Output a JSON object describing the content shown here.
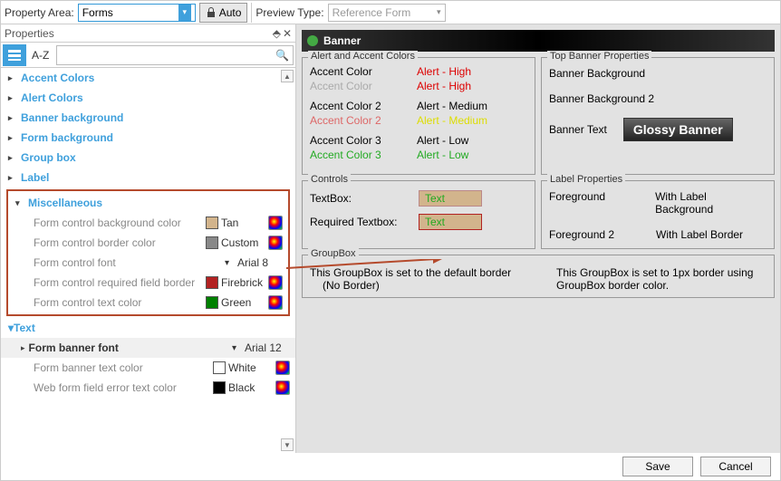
{
  "toolbar": {
    "propertyAreaLabel": "Property Area:",
    "propertyAreaValue": "Forms",
    "autoLabel": "Auto",
    "previewTypeLabel": "Preview Type:",
    "previewTypeValue": "Reference Form"
  },
  "propertiesPanel": {
    "title": "Properties",
    "azLabel": "A-Z",
    "categories": [
      "Accent Colors",
      "Alert Colors",
      "Banner background",
      "Form background",
      "Group box",
      "Label"
    ],
    "misc": {
      "title": "Miscellaneous",
      "rows": [
        {
          "name": "Form control background color",
          "color": "#d2b48c",
          "value": "Tan"
        },
        {
          "name": "Form control border color",
          "color": "#888888",
          "value": "Custom"
        },
        {
          "name": "Form control font",
          "font": true,
          "value": "Arial 8"
        },
        {
          "name": "Form control required field border",
          "color": "#b22222",
          "value": "Firebrick"
        },
        {
          "name": "Form control text color",
          "color": "#008000",
          "value": "Green"
        }
      ]
    },
    "text": {
      "title": "Text",
      "rows": [
        {
          "name": "Form banner font",
          "font": true,
          "value": "Arial 12",
          "bold": true
        },
        {
          "name": "Form banner text color",
          "color": "#ffffff",
          "value": "White"
        },
        {
          "name": "Web form field error text color",
          "color": "#000000",
          "value": "Black"
        }
      ]
    }
  },
  "preview": {
    "bannerTitle": "Banner",
    "alertFieldset": {
      "legend": "Alert and Accent Colors",
      "rows": [
        [
          "Accent Color",
          "Alert - High",
          "#000",
          "#d00"
        ],
        [
          "Accent Color",
          "Alert - High",
          "#aaa",
          "#d00"
        ],
        [
          "Accent Color 2",
          "Alert - Medium",
          "#000",
          "#000"
        ],
        [
          "Accent Color 2",
          "Alert - Medium",
          "#d66",
          "#dd0"
        ],
        [
          "Accent Color 3",
          "Alert - Low",
          "#000",
          "#000"
        ],
        [
          "Accent Color 3",
          "Alert - Low",
          "#2a2",
          "#2a2"
        ]
      ]
    },
    "topBanner": {
      "legend": "Top Banner Properties",
      "rows": [
        "Banner Background",
        "Banner Background 2",
        "Banner Text"
      ],
      "glossy": "Glossy Banner"
    },
    "controls": {
      "legend": "Controls",
      "textbox": "TextBox:",
      "textboxVal": "Text",
      "required": "Required Textbox:",
      "requiredVal": "Text"
    },
    "labelProps": {
      "legend": "Label Properties",
      "rows": [
        [
          "Foreground",
          "With Label Background"
        ],
        [
          "Foreground 2",
          "With Label Border"
        ]
      ]
    },
    "groupbox": {
      "legend": "GroupBox",
      "left": "This GroupBox is set to the default border",
      "leftSub": "(No Border)",
      "right": "This GroupBox is set to 1px border using GroupBox border color."
    }
  },
  "footer": {
    "save": "Save",
    "cancel": "Cancel"
  }
}
